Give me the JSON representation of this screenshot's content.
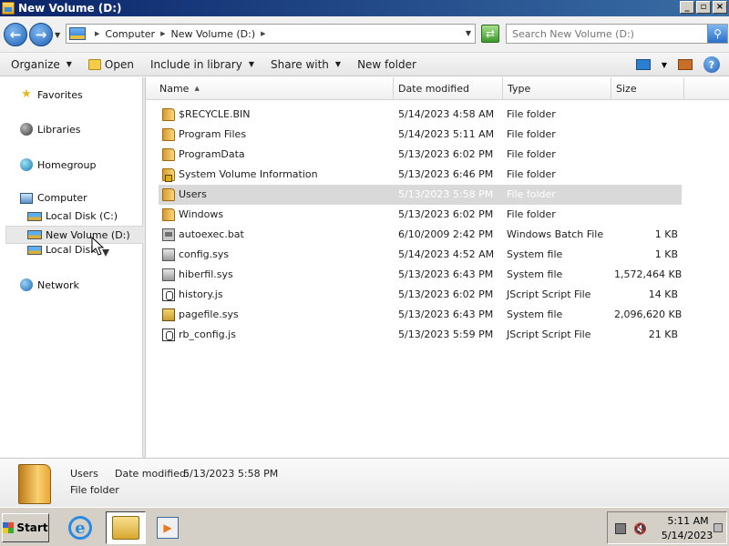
{
  "window": {
    "title": "New Volume (D:)",
    "minimize": "_",
    "maximize": "▫",
    "close": "×"
  },
  "address": {
    "segments": [
      "Computer",
      "New Volume (D:)"
    ],
    "search_placeholder": "Search New Volume (D:)"
  },
  "toolbar": {
    "organize": "Organize",
    "open": "Open",
    "include": "Include in library",
    "share": "Share with",
    "new_folder": "New folder"
  },
  "nav": {
    "favorites": "Favorites",
    "libraries": "Libraries",
    "homegroup": "Homegroup",
    "computer": "Computer",
    "drive_c": "Local Disk (C:)",
    "drive_d": "New Volume (D:)",
    "drive_e": "Local Disk",
    "network": "Network"
  },
  "columns": {
    "name": "Name",
    "date": "Date modified",
    "type": "Type",
    "size": "Size"
  },
  "files": [
    {
      "name": "$RECYCLE.BIN",
      "date": "5/14/2023 4:58 AM",
      "type": "File folder",
      "size": "",
      "icon": "folder-icon"
    },
    {
      "name": "Program Files",
      "date": "5/14/2023 5:11 AM",
      "type": "File folder",
      "size": "",
      "icon": "folder-icon"
    },
    {
      "name": "ProgramData",
      "date": "5/13/2023 6:02 PM",
      "type": "File folder",
      "size": "",
      "icon": "folder-icon"
    },
    {
      "name": "System Volume Information",
      "date": "5/13/2023 6:46 PM",
      "type": "File folder",
      "size": "",
      "icon": "lock-folder-icon"
    },
    {
      "name": "Users",
      "date": "5/13/2023 5:58 PM",
      "type": "File folder",
      "size": "",
      "icon": "folder-icon"
    },
    {
      "name": "Windows",
      "date": "5/13/2023 6:02 PM",
      "type": "File folder",
      "size": "",
      "icon": "folder-icon"
    },
    {
      "name": "autoexec.bat",
      "date": "6/10/2009 2:42 PM",
      "type": "Windows Batch File",
      "size": "1 KB",
      "icon": "batch-file-icon"
    },
    {
      "name": "config.sys",
      "date": "5/14/2023 4:52 AM",
      "type": "System file",
      "size": "1 KB",
      "icon": "system-file-icon"
    },
    {
      "name": "hiberfil.sys",
      "date": "5/13/2023 6:43 PM",
      "type": "System file",
      "size": "1,572,464 KB",
      "icon": "system-file-icon"
    },
    {
      "name": "history.js",
      "date": "5/13/2023 6:02 PM",
      "type": "JScript Script File",
      "size": "14 KB",
      "icon": "script-file-icon"
    },
    {
      "name": "pagefile.sys",
      "date": "5/13/2023 6:43 PM",
      "type": "System file",
      "size": "2,096,620 KB",
      "icon": "pagefile-icon"
    },
    {
      "name": "rb_config.js",
      "date": "5/13/2023 5:59 PM",
      "type": "JScript Script File",
      "size": "21 KB",
      "icon": "script-file-icon"
    }
  ],
  "selected_index": 4,
  "details": {
    "name": "Users",
    "date_label": "Date modified:",
    "date_value": "5/13/2023 5:58 PM",
    "type": "File folder"
  },
  "taskbar": {
    "start": "Start",
    "time": "5:11 AM",
    "date": "5/14/2023"
  }
}
